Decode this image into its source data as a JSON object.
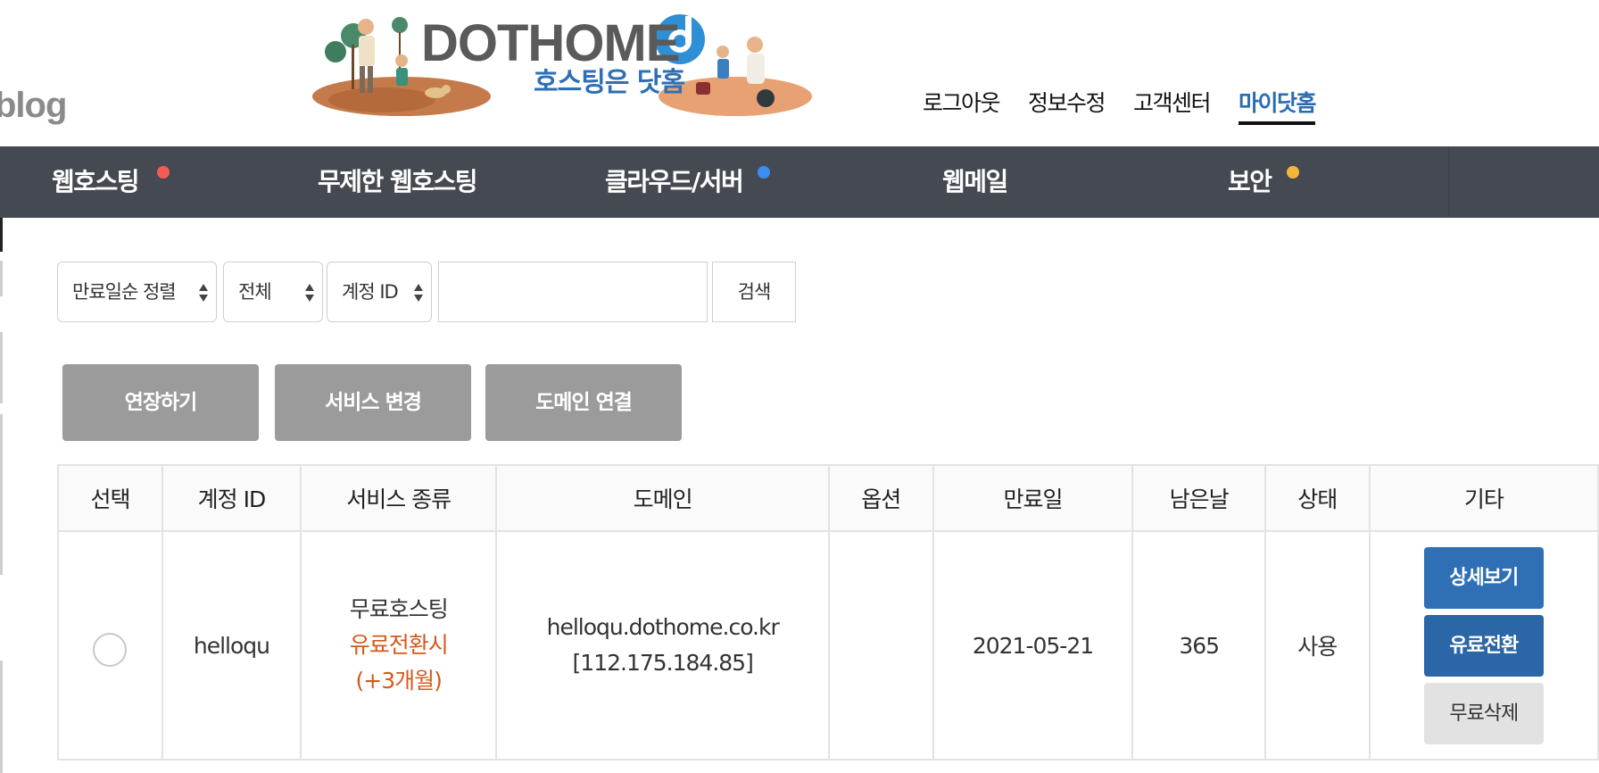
{
  "header": {
    "blog_text": "blog",
    "logo_title": "DOTHOME",
    "logo_sub": "호스팅은 닷홈",
    "links": [
      "로그아웃",
      "정보수정",
      "고객센터",
      "마이닷홈"
    ]
  },
  "nav": {
    "items": [
      {
        "label": "웹호스팅",
        "dot": "#f25c54"
      },
      {
        "label": "무제한 웹호스팅"
      },
      {
        "label": "클라우드/서버",
        "dot": "#3b8ff0"
      },
      {
        "label": "웹메일"
      },
      {
        "label": "보안",
        "dot": "#f5b63a"
      }
    ]
  },
  "filters": {
    "sort": "만료일순 정렬",
    "scope": "전체",
    "field": "계정 ID",
    "search_value": "",
    "search_button": "검색"
  },
  "actions": [
    "연장하기",
    "서비스 변경",
    "도메인 연결"
  ],
  "table": {
    "headers": [
      "선택",
      "계정 ID",
      "서비스 종류",
      "도메인",
      "옵션",
      "만료일",
      "남은날",
      "상태",
      "기타"
    ],
    "rows": [
      {
        "account_id": "helloqu",
        "service_lines": [
          "무료호스팅",
          "유료전환시",
          "(+3개월)"
        ],
        "domain": "helloqu.dothome.co.kr",
        "ip": "[112.175.184.85]",
        "option": "",
        "expires": "2021-05-21",
        "remaining": "365",
        "status": "사용",
        "buttons": [
          "상세보기",
          "유료전환",
          "무료삭제"
        ]
      }
    ]
  },
  "colors": {
    "nav_bg": "#454a52",
    "accent_blue": "#2e6fb5",
    "action_gray": "#9b9b9b",
    "highlight_orange": "#d35a1c"
  }
}
